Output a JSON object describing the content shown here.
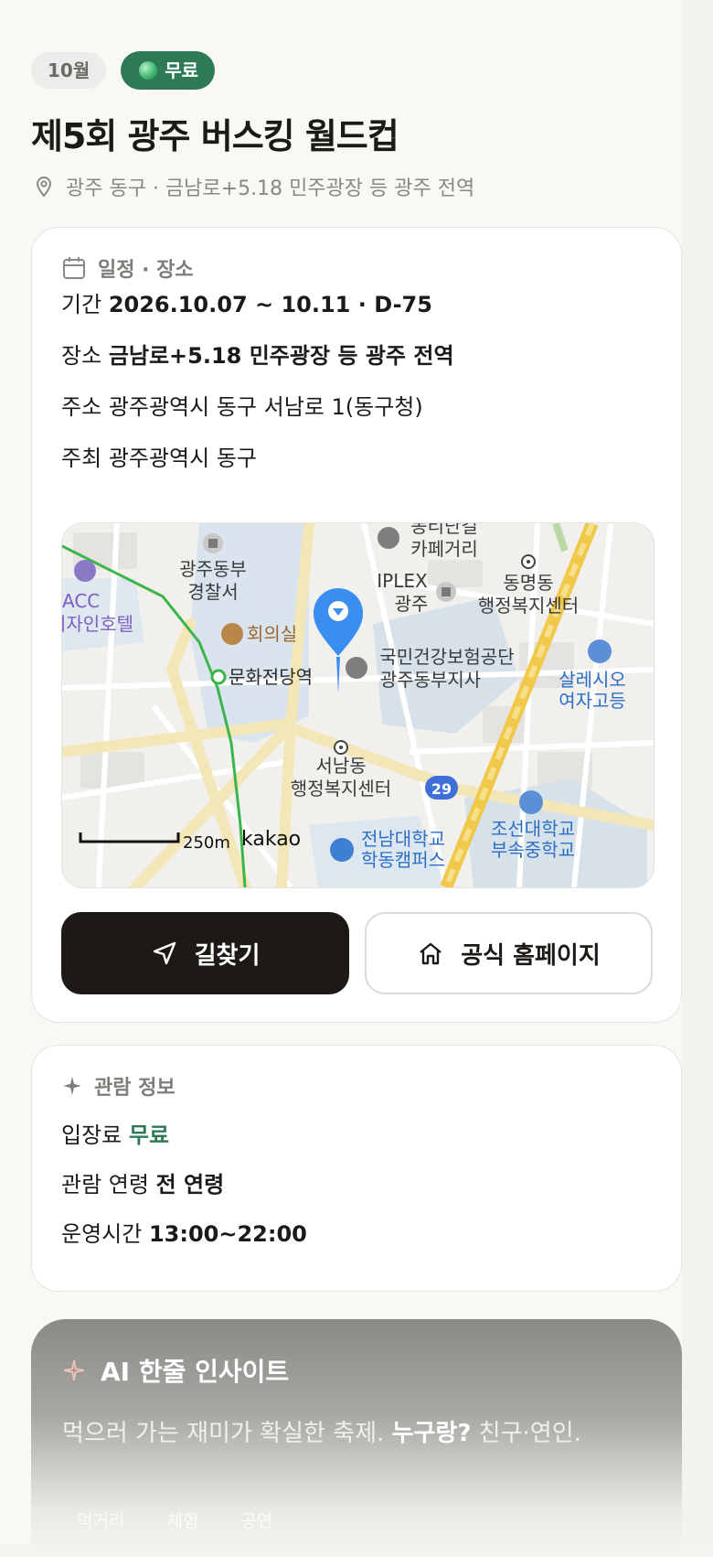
{
  "tags": {
    "month": "10월",
    "price": "무료"
  },
  "event": {
    "title": "제5회 광주 버스킹 월드컵",
    "location_line": "광주 동구 · 금남로+5.18 민주광장 등 광주 전역"
  },
  "schedule": {
    "heading": "일정 · 장소",
    "period_label": "기간",
    "period_value": "2026.10.07 ~ 10.11 · D-75",
    "venue_label": "장소",
    "venue_value": "금남로+5.18 민주광장 등 광주 전역",
    "address_label": "주소",
    "address_value": "광주광역시 동구 서남로 1(동구청)",
    "host_label": "주최",
    "host_value": "광주광역시 동구"
  },
  "map": {
    "labels": {
      "police": [
        "광주동부",
        "경찰서"
      ],
      "acc": [
        "ACC",
        "디자인호텔"
      ],
      "hall": "회의실",
      "station": "문화전당역",
      "cafe": [
        "동리단길",
        "카페거리"
      ],
      "iplex": [
        "IPLEX",
        "광주"
      ],
      "dongmyeong": [
        "동명동",
        "행정복지센터"
      ],
      "nhis": [
        "국민건강보험공단",
        "광주동부지사"
      ],
      "salesian": [
        "살레시오",
        "여자고등"
      ],
      "seonam": [
        "서남동",
        "행정복지센터"
      ],
      "jnu": [
        "전남대학교",
        "학동캠퍼스"
      ],
      "chosun": [
        "조선대학교",
        "부속중학교"
      ],
      "route": "29"
    },
    "scale": "250m",
    "brand": "kakao"
  },
  "buttons": {
    "directions": "길찾기",
    "homepage": "공식 홈페이지"
  },
  "viewing": {
    "heading": "관람 정보",
    "fee_label": "입장료",
    "fee_value": "무료",
    "age_label": "관람 연령",
    "age_value": "전 연령",
    "hours_label": "운영시간",
    "hours_value": "13:00~22:00"
  },
  "ai": {
    "heading": "AI 한줄 인사이트",
    "text_prefix": "먹으러 가는 재미가 확실한 축제.",
    "text_bold": "누구랑?",
    "text_suffix": "친구·연인.",
    "chips": [
      "먹거리",
      "체험",
      "공연"
    ]
  }
}
